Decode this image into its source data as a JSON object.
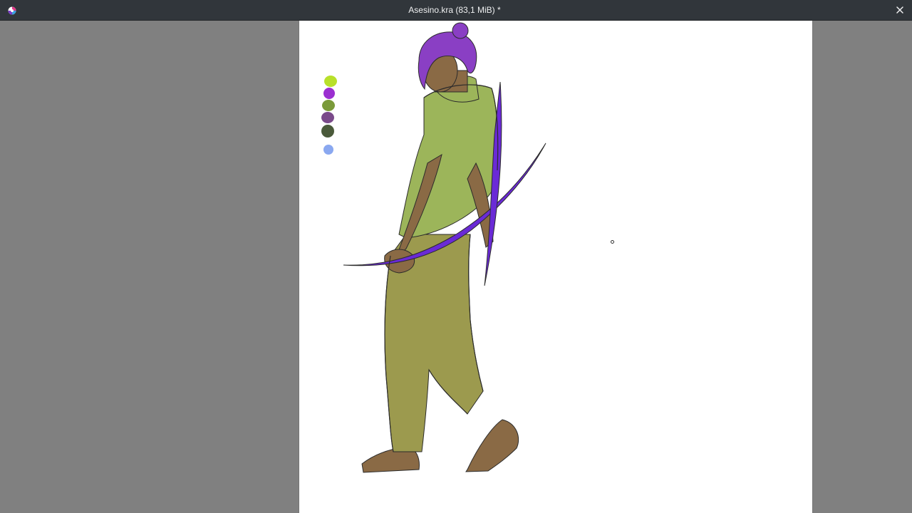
{
  "window": {
    "title": "Asesino.kra (83,1 MiB) *",
    "close_icon": "close-icon",
    "app_icon": "krita-app-icon"
  },
  "canvas": {
    "background": "#ffffff",
    "workspace_color": "#808080"
  },
  "palette": {
    "swatches": [
      "#b8e02a",
      "#9b2fd0",
      "#7a9a3a",
      "#7a4a8a",
      "#4a5a3a",
      "#8aa8f0"
    ]
  },
  "artwork": {
    "colors": {
      "hair": "#8a3fc4",
      "shirt": "#9cb55a",
      "pants": "#9c9a4e",
      "skin": "#8a6a45",
      "blade": "#6a2ad6",
      "line": "#2b2b2b"
    }
  }
}
